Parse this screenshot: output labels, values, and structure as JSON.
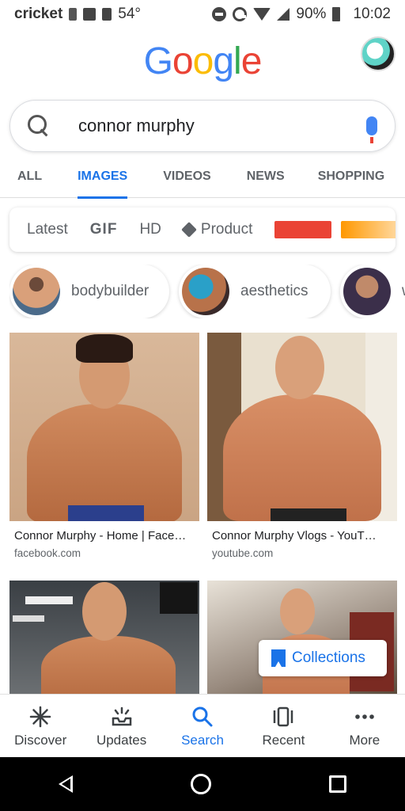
{
  "status_bar": {
    "carrier": "cricket",
    "temperature": "54°",
    "battery": "90%",
    "time": "10:02"
  },
  "logo": {
    "letters": [
      {
        "ch": "G",
        "color": "#4285f4"
      },
      {
        "ch": "o",
        "color": "#ea4335"
      },
      {
        "ch": "o",
        "color": "#fbbc05"
      },
      {
        "ch": "g",
        "color": "#4285f4"
      },
      {
        "ch": "l",
        "color": "#34a853"
      },
      {
        "ch": "e",
        "color": "#ea4335"
      }
    ]
  },
  "search": {
    "query": "connor murphy"
  },
  "tabs": [
    {
      "label": "ALL",
      "active": false
    },
    {
      "label": "IMAGES",
      "active": true
    },
    {
      "label": "VIDEOS",
      "active": false
    },
    {
      "label": "NEWS",
      "active": false
    },
    {
      "label": "SHOPPING",
      "active": false
    }
  ],
  "filters": {
    "latest": "Latest",
    "gif": "GIF",
    "hd": "HD",
    "product": "Product",
    "swatch_colors": [
      "#ea4335",
      "#ff9800"
    ]
  },
  "suggestions": [
    {
      "label": "bodybuilder"
    },
    {
      "label": "aesthetics"
    },
    {
      "label": "w"
    }
  ],
  "results": [
    {
      "title": "Connor Murphy - Home | Face…",
      "source": "facebook.com"
    },
    {
      "title": "Connor Murphy Vlogs - YouT…",
      "source": "youtube.com"
    },
    {
      "title": "",
      "source": ""
    },
    {
      "title": "",
      "source": ""
    }
  ],
  "collections_button": {
    "label": "Collections"
  },
  "bottom_nav": [
    {
      "label": "Discover",
      "icon": "asterisk-icon",
      "active": false
    },
    {
      "label": "Updates",
      "icon": "updates-icon",
      "active": false
    },
    {
      "label": "Search",
      "icon": "search-icon",
      "active": true
    },
    {
      "label": "Recent",
      "icon": "recent-tabs-icon",
      "active": false
    },
    {
      "label": "More",
      "icon": "more-dots-icon",
      "active": false
    }
  ],
  "colors": {
    "accent": "#1a73e8"
  }
}
